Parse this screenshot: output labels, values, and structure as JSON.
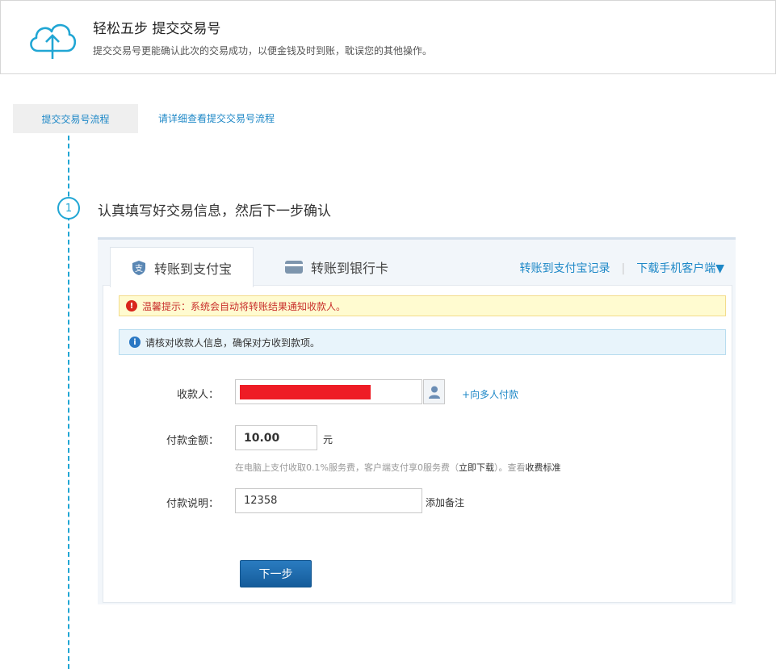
{
  "header": {
    "title": "轻松五步 提交交易号",
    "description": "提交交易号更能确认此次的交易成功，以便金钱及时到账，耽误您的其他操作。"
  },
  "tabs": {
    "flow_tab": "提交交易号流程",
    "flow_link": "请详细查看提交交易号流程"
  },
  "step": {
    "number": "1",
    "title": "认真填写好交易信息，然后下一步确认"
  },
  "panel": {
    "tab_alipay": "转账到支付宝",
    "tab_bank": "转账到银行卡",
    "link_records": "转账到支付宝记录",
    "separator": "|",
    "link_download": "下载手机客户端▼",
    "warning": "温馨提示：系统会自动将转账结果通知收款人。",
    "info": "请核对收款人信息，确保对方收到款项。"
  },
  "form": {
    "payee_label": "收款人：",
    "multi_payee_link": "+向多人付款",
    "amount_label": "付款金额：",
    "amount_value": "10.00",
    "currency_unit": "元",
    "hint_prefix": "在电脑上支付收取0.1%服务费，客户端支付享0服务费（",
    "hint_download": "立即下载",
    "hint_middle": "）。查看",
    "hint_fee": "收费标准",
    "note_label": "付款说明：",
    "note_value": "12358",
    "add_note": "添加备注",
    "next_button": "下一步"
  },
  "colors": {
    "accent": "#1e88c7",
    "timeline": "#21a6d4",
    "warning_text": "#c9302c",
    "redaction": "#ee1c25"
  }
}
